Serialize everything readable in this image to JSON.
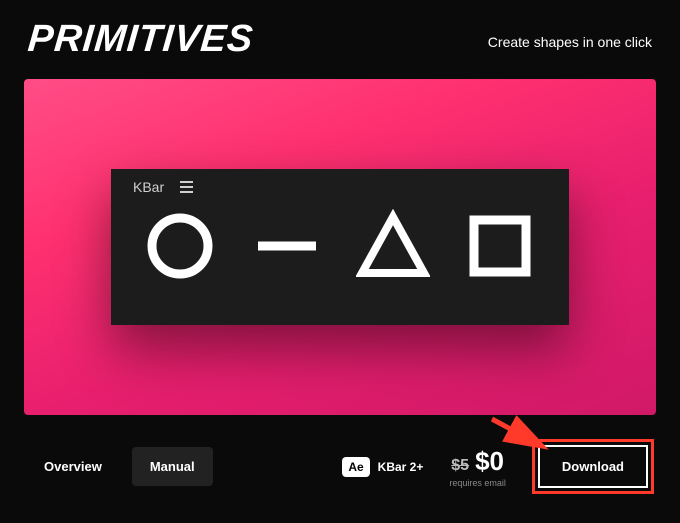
{
  "header": {
    "logo": "PRIMITIVES",
    "tagline": "Create shapes in one click"
  },
  "panel": {
    "title": "KBar"
  },
  "tabs": {
    "overview": "Overview",
    "manual": "Manual"
  },
  "meta": {
    "ae_badge": "Ae",
    "kbar_req": "KBar 2+",
    "old_price": "$5",
    "new_price": "$0",
    "note": "requires email"
  },
  "actions": {
    "download": "Download"
  }
}
